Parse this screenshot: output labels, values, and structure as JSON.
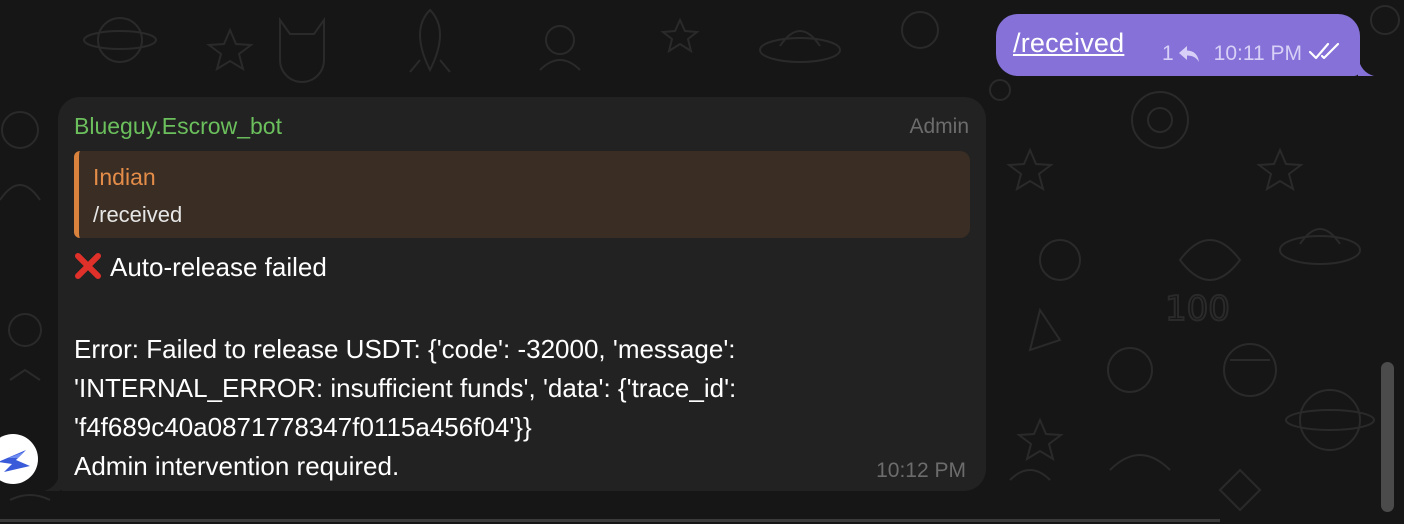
{
  "outgoing_message": {
    "text": "/received",
    "reply_count": "1",
    "time": "10:11 PM",
    "status_icon": "double-check-icon",
    "bubble_color": "#8571d8"
  },
  "incoming_message": {
    "sender": "Blueguy.Escrow_bot",
    "sender_color": "#6bbf5c",
    "role_badge": "Admin",
    "reply": {
      "author": "Indian",
      "text": "/received",
      "accent_color": "#d9823e"
    },
    "status_icon": "red-cross-icon",
    "heading": "Auto-release failed",
    "error_lines": [
      "Error: Failed to release USDT: {'code': -32000, 'message':",
      "'INTERNAL_ERROR: insufficient funds', 'data': {'trace_id':",
      "'f4f689c40a0871778347f0115a456f04'}}"
    ],
    "footer_line": "Admin intervention required.",
    "time": "10:12 PM"
  },
  "theme": {
    "background": "#161616",
    "bubble_background": "#222222"
  }
}
